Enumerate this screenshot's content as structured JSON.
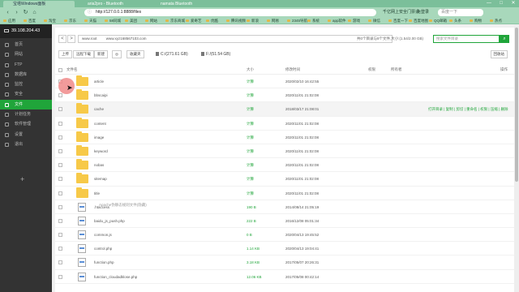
{
  "browser": {
    "tabs": [
      "宝塔Windows面板",
      "aria2pro - Bluetooth",
      "namata Bluetooth"
    ],
    "url": "http://127.0.0.1:8888/files",
    "extensions": [
      "千亿网上安全门票设",
      "免登录"
    ],
    "search_placeholder": "百度一下",
    "bookmarks": [
      "应用",
      "百度",
      "淘宝",
      "京东",
      "天猫",
      "58同城",
      "美团",
      "网站",
      "京东商城",
      "爱奇艺",
      "优酷",
      "腾讯视频",
      "新浪",
      "网易",
      "2345导航",
      "系统",
      "app软件",
      "游戏",
      "微信",
      "百度一下",
      "百度地图",
      "QQ邮箱",
      "头条",
      "购物",
      "热点"
    ]
  },
  "sidebar": {
    "server_label": "39.108.204.43",
    "items": [
      {
        "label": "首页"
      },
      {
        "label": "网站"
      },
      {
        "label": "FTP"
      },
      {
        "label": "数据库"
      },
      {
        "label": "监控"
      },
      {
        "label": "安全"
      },
      {
        "label": "文件",
        "active": true
      },
      {
        "label": "计划任务"
      },
      {
        "label": "软件管理"
      },
      {
        "label": "设置"
      },
      {
        "label": "退出"
      }
    ],
    "add_label": "+"
  },
  "path_bar": {
    "back": "<",
    "forward": ">",
    "segments": [
      "www.root",
      "www.xyz168567103.com"
    ],
    "info": "共0个目录与9个文件,大小:(1.54/2.00 GB)",
    "search_placeholder": "搜索文件目录",
    "search_icon": "search-icon"
  },
  "toolbar": {
    "buttons": [
      "上传",
      "远程下载",
      "新建",
      "◎",
      "收藏夹"
    ],
    "disks": [
      "C:/(271.61 GB)",
      "F:/(51.54 GB)"
    ],
    "recycle_label": "回收站"
  },
  "table": {
    "headers": {
      "name": "文件名",
      "size": "大小",
      "mtime": "修改时间",
      "perm": "权限",
      "owner": "所有者",
      "ops": "操作"
    },
    "rows": [
      {
        "type": "folder",
        "name": "article",
        "size": "计算",
        "mtime": "2020/02/10 16:42:55"
      },
      {
        "type": "folder",
        "name": "bbscaipi",
        "size": "计算",
        "mtime": "2020/11/01 21:02:08"
      },
      {
        "type": "folder",
        "name": "cache",
        "size": "计算",
        "mtime": "2018/03/17 21:08:01",
        "highlight": true,
        "ops": "打开目录 | 复制 | 剪切 | 重命名 | 权限 | 压缩 | 删除"
      },
      {
        "type": "folder",
        "name": "content",
        "size": "计算",
        "mtime": "2020/11/01 21:02:08"
      },
      {
        "type": "folder",
        "name": "image",
        "size": "计算",
        "mtime": "2020/11/01 21:02:08"
      },
      {
        "type": "folder",
        "name": "keyword",
        "size": "计算",
        "mtime": "2020/11/01 21:02:08"
      },
      {
        "type": "folder",
        "name": "nobas",
        "size": "计算",
        "mtime": "2020/11/01 21:02:08"
      },
      {
        "type": "folder",
        "name": "sitemap",
        "size": "计算",
        "mtime": "2020/11/01 21:02:08"
      },
      {
        "type": "folder",
        "name": "title",
        "size": "计算",
        "mtime": "2020/11/01 21:02:08"
      },
      {
        "type": "file",
        "name": ".htaccess",
        "size": "190 B",
        "mtime": "2014/08/14 21:05:19"
      },
      {
        "type": "file",
        "name": "baidu_js_push.php",
        "size": "222 B",
        "mtime": "2016/12/08 05:01:34"
      },
      {
        "type": "file",
        "name": "common.js",
        "size": "0 B",
        "mtime": "2020/04/13 19:45:52"
      },
      {
        "type": "file",
        "name": "control.php",
        "size": "1.14 KB",
        "mtime": "2020/04/13 19:04:41"
      },
      {
        "type": "file",
        "name": "function.php",
        "size": "3.18 KB",
        "mtime": "2017/05/07 20:26:31"
      },
      {
        "type": "file",
        "name": "function_cloudadklose.php",
        "size": "12.06 KB",
        "mtime": "2017/05/08 00:42:14"
      }
    ],
    "tooltip": "Apache伪静态规则文件(隐藏)"
  },
  "colors": {
    "accent": "#20a53a",
    "sidebar": "#333333",
    "chrome": "#a8d8bb"
  }
}
